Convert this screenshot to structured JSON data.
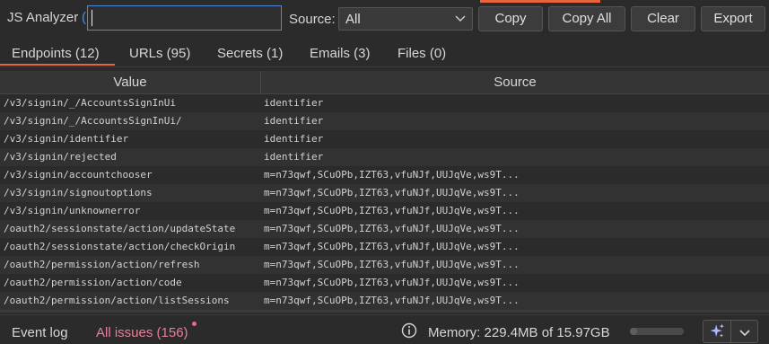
{
  "colors": {
    "accent": "#e8643c",
    "focus": "#4a87d9",
    "issues": "#e87f9a"
  },
  "header": {
    "title": "JS Analyzer",
    "title_paren": "(",
    "search": {
      "value": "",
      "placeholder": ""
    },
    "source_label": "Source:",
    "source_selected": "All",
    "buttons": {
      "copy": "Copy",
      "copy_all": "Copy All",
      "clear": "Clear",
      "export": "Export"
    }
  },
  "tabs": [
    {
      "label": "Endpoints (12)",
      "active": true
    },
    {
      "label": "URLs (95)"
    },
    {
      "label": "Secrets (1)"
    },
    {
      "label": "Emails (3)"
    },
    {
      "label": "Files (0)"
    }
  ],
  "table": {
    "columns": [
      "Value",
      "Source"
    ],
    "rows": [
      {
        "value": "/v3/signin/_/AccountsSignInUi",
        "source": "identifier"
      },
      {
        "value": "/v3/signin/_/AccountsSignInUi/",
        "source": "identifier"
      },
      {
        "value": "/v3/signin/identifier",
        "source": "identifier"
      },
      {
        "value": "/v3/signin/rejected",
        "source": "identifier"
      },
      {
        "value": "/v3/signin/accountchooser",
        "source": "m=n73qwf,SCuOPb,IZT63,vfuNJf,UUJqVe,ws9T..."
      },
      {
        "value": "/v3/signin/signoutoptions",
        "source": "m=n73qwf,SCuOPb,IZT63,vfuNJf,UUJqVe,ws9T..."
      },
      {
        "value": "/v3/signin/unknownerror",
        "source": "m=n73qwf,SCuOPb,IZT63,vfuNJf,UUJqVe,ws9T..."
      },
      {
        "value": "/oauth2/sessionstate/action/updateState",
        "source": "m=n73qwf,SCuOPb,IZT63,vfuNJf,UUJqVe,ws9T..."
      },
      {
        "value": "/oauth2/sessionstate/action/checkOrigin",
        "source": "m=n73qwf,SCuOPb,IZT63,vfuNJf,UUJqVe,ws9T..."
      },
      {
        "value": "/oauth2/permission/action/refresh",
        "source": "m=n73qwf,SCuOPb,IZT63,vfuNJf,UUJqVe,ws9T..."
      },
      {
        "value": "/oauth2/permission/action/code",
        "source": "m=n73qwf,SCuOPb,IZT63,vfuNJf,UUJqVe,ws9T..."
      },
      {
        "value": "/oauth2/permission/action/listSessions",
        "source": "m=n73qwf,SCuOPb,IZT63,vfuNJf,UUJqVe,ws9T..."
      }
    ]
  },
  "statusbar": {
    "event_log": "Event log",
    "all_issues": "All issues (156)",
    "memory": "Memory: 229.4MB of 15.97GB",
    "memory_used_fraction": 0.014,
    "icons": {
      "info": "info-icon",
      "ai": "sparkle-icon",
      "menu": "chevron-down-icon"
    }
  }
}
